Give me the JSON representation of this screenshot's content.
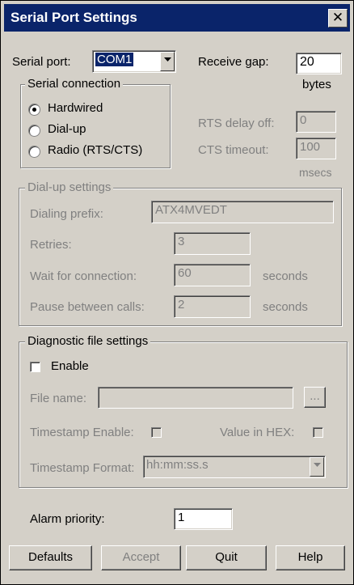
{
  "window": {
    "title": "Serial Port Settings",
    "close_glyph": "✕"
  },
  "serial_port": {
    "label": "Serial port:",
    "value": "COM1"
  },
  "receive_gap": {
    "label": "Receive gap:",
    "value": "20",
    "unit": "bytes"
  },
  "serial_connection": {
    "title": "Serial connection",
    "options": [
      "Hardwired",
      "Dial-up",
      "Radio (RTS/CTS)"
    ],
    "selected": "Hardwired"
  },
  "rts_delay_off": {
    "label": "RTS delay off:",
    "value": "0"
  },
  "cts_timeout": {
    "label": "CTS timeout:",
    "value": "100"
  },
  "msecs_label": "msecs",
  "dialup": {
    "title": "Dial-up settings",
    "dialing_prefix": {
      "label": "Dialing prefix:",
      "value": "ATX4MVEDT"
    },
    "retries": {
      "label": "Retries:",
      "value": "3"
    },
    "wait_for_connection": {
      "label": "Wait for connection:",
      "value": "60",
      "unit": "seconds"
    },
    "pause_between_calls": {
      "label": "Pause between calls:",
      "value": "2",
      "unit": "seconds"
    }
  },
  "diagnostic": {
    "title": "Diagnostic file settings",
    "enable_label": "Enable",
    "file_name_label": "File name:",
    "file_name_value": "",
    "browse_label": "...",
    "timestamp_enable_label": "Timestamp Enable:",
    "value_in_hex_label": "Value in HEX:",
    "timestamp_format_label": "Timestamp Format:",
    "timestamp_format_value": "hh:mm:ss.s"
  },
  "alarm_priority": {
    "label": "Alarm priority:",
    "value": "1"
  },
  "buttons": {
    "defaults": "Defaults",
    "accept": "Accept",
    "quit": "Quit",
    "help": "Help"
  },
  "colors": {
    "face": "#d4d0c8",
    "title_bar": "#0a246a",
    "disabled_text": "#808080"
  }
}
